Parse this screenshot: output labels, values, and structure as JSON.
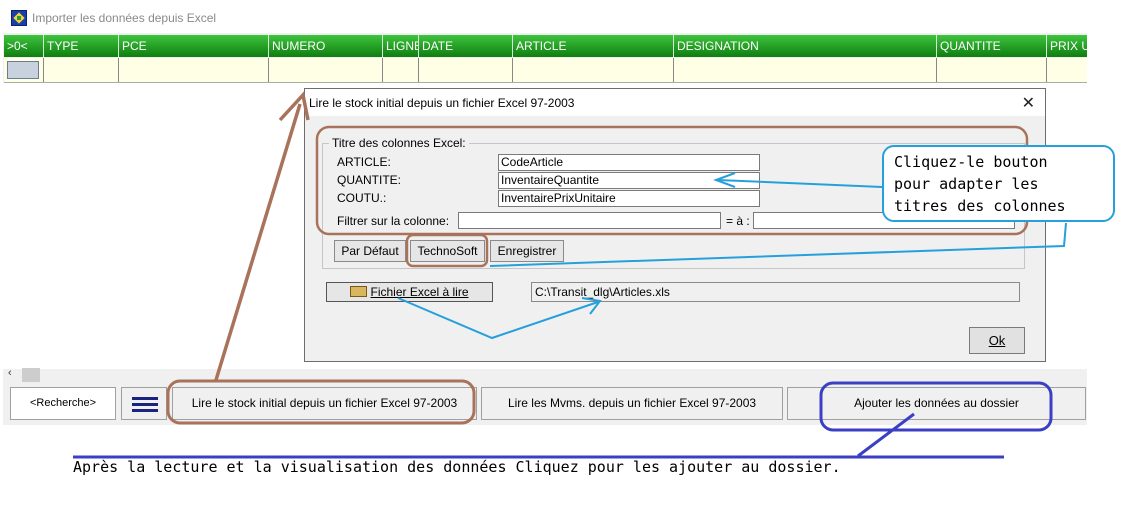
{
  "window": {
    "title": "Importer les données depuis Excel"
  },
  "grid": {
    "columns": [
      ">0<",
      "TYPE",
      "PCE",
      "NUMERO",
      "LIGNE",
      "DATE",
      "ARTICLE",
      "DESIGNATION",
      "QUANTITE",
      "PRIX U"
    ]
  },
  "bottom_bar": {
    "recherche_label": "<Recherche>",
    "lire_stock_label": "Lire le stock initial depuis un fichier Excel 97-2003",
    "lire_mvms_label": "Lire les Mvms. depuis un fichier Excel 97-2003",
    "ajouter_label": "Ajouter les données au dossier"
  },
  "dialog": {
    "title": "Lire le stock initial depuis un fichier Excel 97-2003",
    "close_glyph": "✕",
    "group_label": "Titre des colonnes Excel:",
    "fields": [
      {
        "label": "ARTICLE:",
        "value": "CodeArticle"
      },
      {
        "label": "QUANTITE:",
        "value": "InventaireQuantite"
      },
      {
        "label": "COUTU.:",
        "value": "InventairePrixUnitaire"
      }
    ],
    "filter_label": "Filtrer sur la colonne:",
    "filter_value": "",
    "filter_to_label": "= à :",
    "filter_to_value": "",
    "buttons": {
      "default": "Par Défaut",
      "technosoft": "TechnoSoft",
      "save": "Enregistrer"
    },
    "file_button": "Fichier Excel à lire",
    "file_path": "C:\\Transit_dlg\\Articles.xls",
    "ok": "Ok"
  },
  "annotations": {
    "callout": "Cliquez-le bouton\npour adapter les\ntitres des colonnes",
    "caption": "Après la lecture et la visualisation des données Cliquez pour les ajouter au dossier.",
    "colors": {
      "brown": "#a8735a",
      "blue": "#26a0dc",
      "navy": "#3b3fc4"
    }
  }
}
